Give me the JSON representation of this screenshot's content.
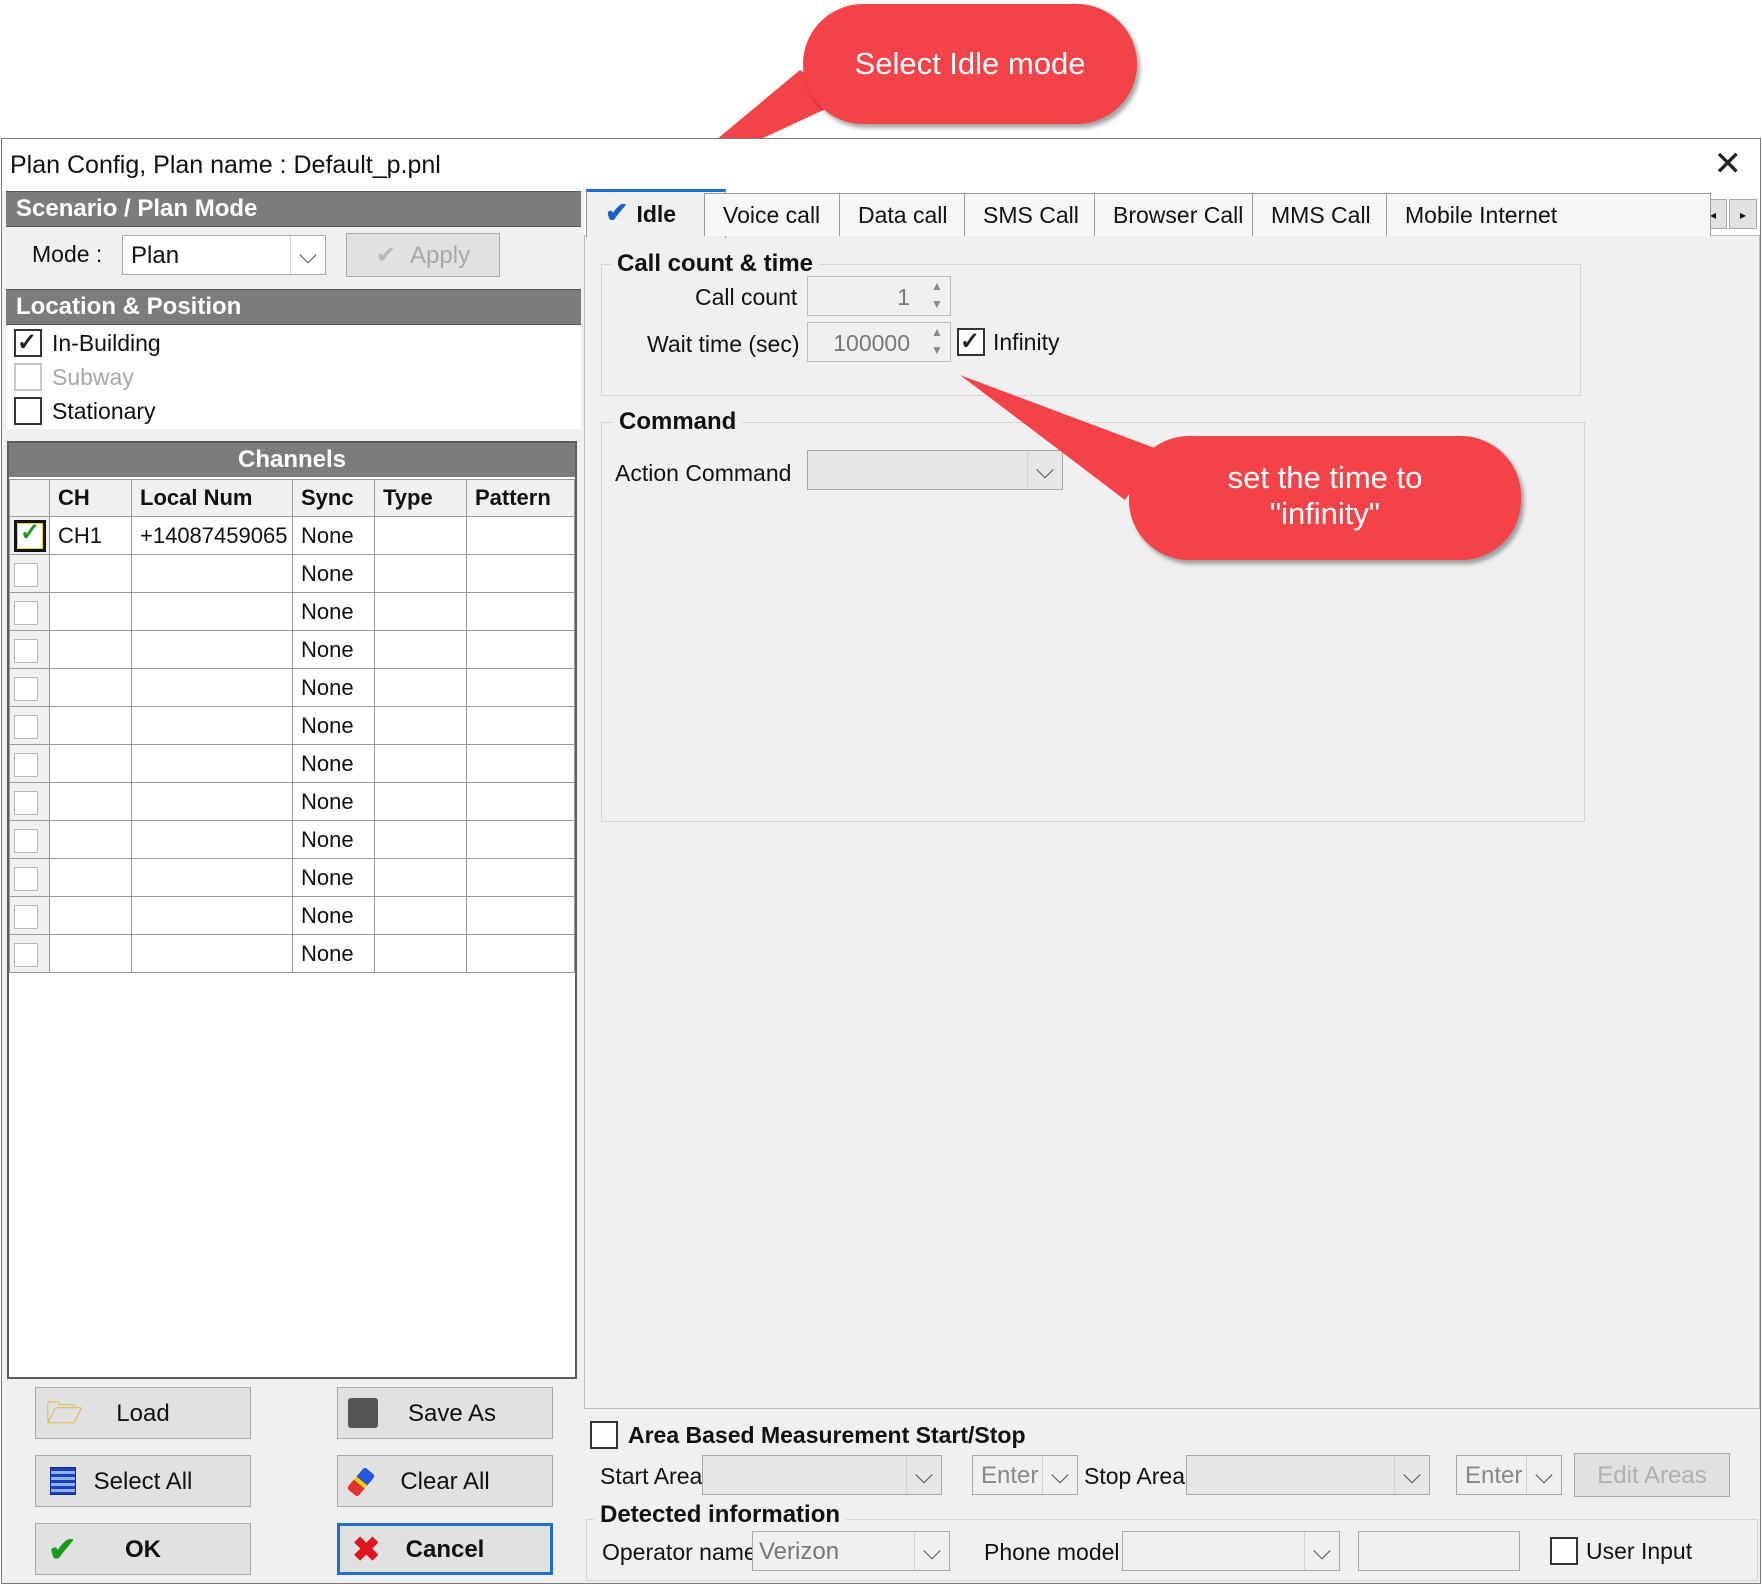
{
  "callouts": {
    "select_idle": "Select Idle mode",
    "set_time": "set the time to \"infinity\""
  },
  "window": {
    "title": "Plan Config, Plan name : Default_p.pnl",
    "close_icon": "close-icon"
  },
  "scenario": {
    "header": "Scenario / Plan Mode",
    "mode_label": "Mode :",
    "mode_value": "Plan",
    "apply_label": "Apply"
  },
  "location": {
    "header": "Location & Position",
    "options": [
      {
        "label": "In-Building",
        "checked": true,
        "enabled": true
      },
      {
        "label": "Subway",
        "checked": false,
        "enabled": false
      },
      {
        "label": "Stationary",
        "checked": false,
        "enabled": true
      }
    ]
  },
  "channels": {
    "header": "Channels",
    "columns": [
      "",
      "CH",
      "Local Num",
      "Sync",
      "Type",
      "Pattern"
    ],
    "rows": [
      {
        "checked": true,
        "ch": "CH1",
        "local_num": "+14087459065",
        "sync": "None",
        "type": "",
        "pattern": ""
      },
      {
        "checked": false,
        "ch": "",
        "local_num": "",
        "sync": "None",
        "type": "",
        "pattern": ""
      },
      {
        "checked": false,
        "ch": "",
        "local_num": "",
        "sync": "None",
        "type": "",
        "pattern": ""
      },
      {
        "checked": false,
        "ch": "",
        "local_num": "",
        "sync": "None",
        "type": "",
        "pattern": ""
      },
      {
        "checked": false,
        "ch": "",
        "local_num": "",
        "sync": "None",
        "type": "",
        "pattern": ""
      },
      {
        "checked": false,
        "ch": "",
        "local_num": "",
        "sync": "None",
        "type": "",
        "pattern": ""
      },
      {
        "checked": false,
        "ch": "",
        "local_num": "",
        "sync": "None",
        "type": "",
        "pattern": ""
      },
      {
        "checked": false,
        "ch": "",
        "local_num": "",
        "sync": "None",
        "type": "",
        "pattern": ""
      },
      {
        "checked": false,
        "ch": "",
        "local_num": "",
        "sync": "None",
        "type": "",
        "pattern": ""
      },
      {
        "checked": false,
        "ch": "",
        "local_num": "",
        "sync": "None",
        "type": "",
        "pattern": ""
      },
      {
        "checked": false,
        "ch": "",
        "local_num": "",
        "sync": "None",
        "type": "",
        "pattern": ""
      },
      {
        "checked": false,
        "ch": "",
        "local_num": "",
        "sync": "None",
        "type": "",
        "pattern": ""
      }
    ]
  },
  "buttons": {
    "load": "Load",
    "save_as": "Save As",
    "select_all": "Select All",
    "clear_all": "Clear All",
    "ok": "OK",
    "cancel": "Cancel"
  },
  "tabs": [
    "Idle",
    "Voice call",
    "Data call",
    "SMS Call",
    "Browser Call",
    "MMS Call",
    "Mobile Internet"
  ],
  "active_tab": "Idle",
  "idle": {
    "call_group_title": "Call count & time",
    "call_count_label": "Call count",
    "call_count_value": "1",
    "wait_time_label": "Wait time (sec)",
    "wait_time_value": "100000",
    "infinity_label": "Infinity",
    "infinity_checked": true,
    "command_group_title": "Command",
    "action_command_label": "Action Command",
    "action_command_value": ""
  },
  "area": {
    "title": "Area Based Measurement Start/Stop",
    "start_label": "Start Area",
    "start_enter": "Enter",
    "stop_label": "Stop Area",
    "stop_enter": "Enter",
    "edit_areas": "Edit Areas"
  },
  "detected": {
    "title": "Detected information",
    "operator_label": "Operator name",
    "operator_value": "Verizon",
    "phone_model_label": "Phone model",
    "phone_model_value": "",
    "user_input_label": "User Input"
  },
  "colors": {
    "callout": "#f44249",
    "section_header": "#7c7c7c",
    "tab_accent": "#1e6fd0",
    "ok_check": "#1a9a1a",
    "cancel_x": "#e0141e"
  }
}
